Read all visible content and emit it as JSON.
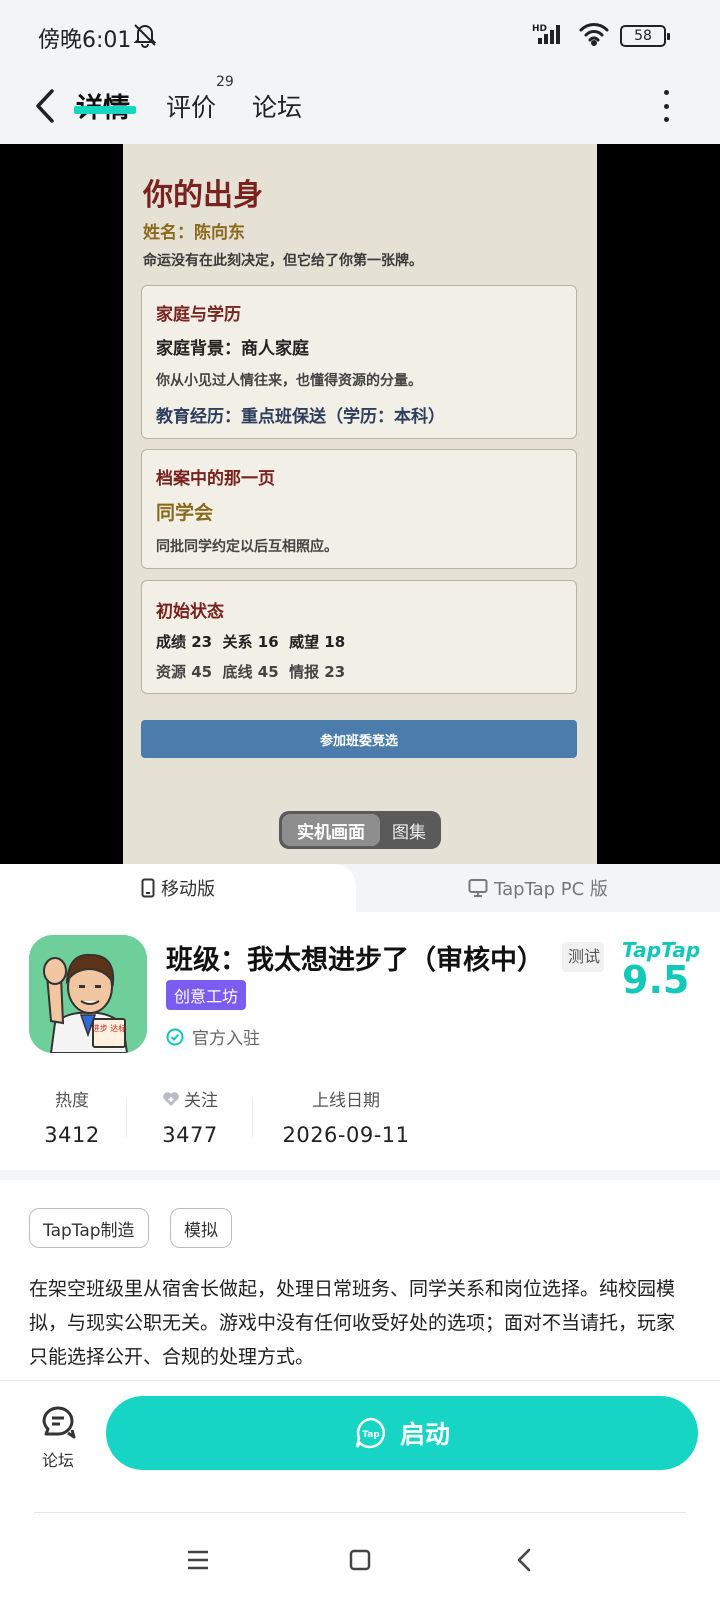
{
  "status_bar": {
    "time": "傍晚6:01",
    "network": "HD",
    "battery": "58"
  },
  "nav": {
    "tabs": [
      {
        "label": "详情",
        "active": true
      },
      {
        "label": "评价",
        "badge": "29"
      },
      {
        "label": "论坛"
      }
    ]
  },
  "game_screen": {
    "title": "你的出身",
    "name_label": "姓名：",
    "name_value": "陈向东",
    "tagline": "命运没有在此刻决定，但它给了你第一张牌。",
    "card1": {
      "title": "家庭与学历",
      "background": "家庭背景：商人家庭",
      "background_desc": "你从小见过人情往来，也懂得资源的分量。",
      "education": "教育经历：重点班保送（学历：本科）"
    },
    "card2": {
      "title": "档案中的那一页",
      "event": "同学会",
      "event_desc": "同批同学约定以后互相照应。"
    },
    "card3": {
      "title": "初始状态",
      "stats_line1": "成绩 23  关系 16  威望 18",
      "stats_line2": "资源 45  底线 45  情报 23"
    },
    "action_button": "参加班委竞选"
  },
  "media_toggle": {
    "active": "实机画面",
    "inactive": "图集"
  },
  "platform_tabs": {
    "mobile": "移动版",
    "pc": "TapTap PC 版"
  },
  "app": {
    "title": "班级：我太想进步了（审核中）",
    "test_badge": "测试",
    "creative_badge": "创意工坊",
    "official": "官方入驻",
    "rating_brand": "TapTap",
    "rating_score": "9.5",
    "icon_sign_text": "进步 达标"
  },
  "stats": [
    {
      "label": "热度",
      "value": "3412"
    },
    {
      "label": "关注",
      "value": "3477"
    },
    {
      "label": "上线日期",
      "value": "2026-09-11"
    }
  ],
  "tags": [
    "TapTap制造",
    "模拟"
  ],
  "description": "在架空班级里从宿舍长做起，处理日常班务、同学关系和岗位选择。纯校园模拟，与现实公职无关。游戏中没有任何收受好处的选项；面对不当请托，玩家只能选择公开、合规的处理方式。",
  "bottom_bar": {
    "forum_label": "论坛",
    "launch_label": "启动",
    "launch_icon_text": "Tap"
  },
  "colors": {
    "accent": "#17d5c4",
    "creative_badge": "#7b5cf0",
    "game_title": "#7a2220",
    "game_button": "#4b7cab"
  }
}
